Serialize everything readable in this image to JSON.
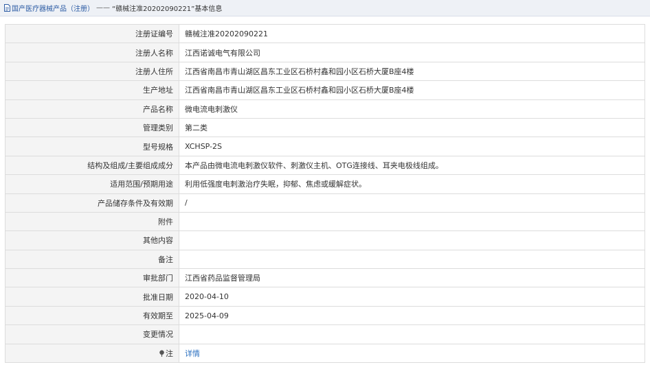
{
  "breadcrumb": {
    "icon": "document-icon",
    "root": "国产医疗器械产品（注册）",
    "separator": "——",
    "current": "“赣械注准20202090221”基本信息"
  },
  "rows": [
    {
      "label": "注册证编号",
      "value": "赣械注准20202090221"
    },
    {
      "label": "注册人名称",
      "value": "江西诺诚电气有限公司"
    },
    {
      "label": "注册人住所",
      "value": "江西省南昌市青山湖区昌东工业区石桥村鑫和园小区石桥大厦B座4楼"
    },
    {
      "label": "生产地址",
      "value": "江西省南昌市青山湖区昌东工业区石桥村鑫和园小区石桥大厦B座4楼"
    },
    {
      "label": "产品名称",
      "value": "微电流电刺激仪"
    },
    {
      "label": "管理类别",
      "value": "第二类"
    },
    {
      "label": "型号规格",
      "value": "XCHSP-2S"
    },
    {
      "label": "结构及组成/主要组成成分",
      "value": "本产品由微电流电刺激仪软件、刺激仪主机、OTG连接线、耳夹电极线组成。"
    },
    {
      "label": "适用范围/预期用途",
      "value": "利用低强度电刺激治疗失眠，抑郁、焦虑或缓解症状。"
    },
    {
      "label": "产品储存条件及有效期",
      "value": "/"
    },
    {
      "label": "附件",
      "value": ""
    },
    {
      "label": "其他内容",
      "value": ""
    },
    {
      "label": "备注",
      "value": ""
    },
    {
      "label": "审批部门",
      "value": "江西省药品监督管理局"
    },
    {
      "label": "批准日期",
      "value": "2020-04-10"
    },
    {
      "label": "有效期至",
      "value": "2025-04-09"
    },
    {
      "label": "变更情况",
      "value": ""
    }
  ],
  "note_row": {
    "icon": "pin-icon",
    "label": "注",
    "link": "详情"
  },
  "colors": {
    "link": "#2a6fc0",
    "label_bg": "#f4f4f4",
    "border": "#dcdcdc",
    "topbar_bg": "#eef1f6"
  }
}
